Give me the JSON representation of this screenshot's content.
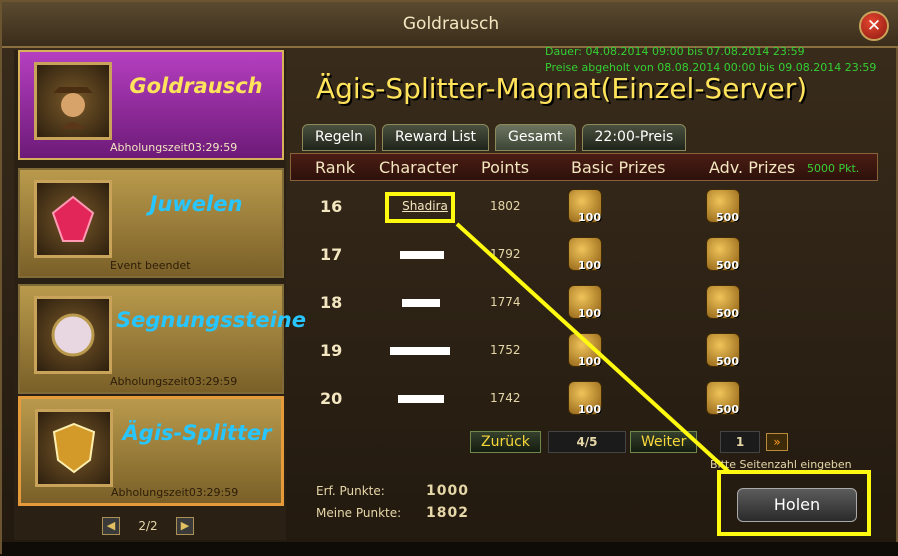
{
  "window": {
    "title": "Goldrausch",
    "close_label": "✕"
  },
  "sidebar": {
    "cards": [
      {
        "name": "Goldrausch",
        "sub": "Abholungszeit03:29:59",
        "state": "active",
        "icon": "cowboy-portrait-icon"
      },
      {
        "name": "Juwelen",
        "sub": "Event beendet",
        "state": "normal",
        "icon": "gem-icon"
      },
      {
        "name": "Segnungssteine",
        "sub": "Abholungszeit03:29:59",
        "state": "normal",
        "icon": "pearl-icon"
      },
      {
        "name": "Ägis-Splitter",
        "sub": "Abholungszeit03:29:59",
        "state": "selected",
        "icon": "shield-icon"
      }
    ],
    "pager": {
      "prev": "◀",
      "label": "2/2",
      "next": "▶"
    }
  },
  "event": {
    "dates": {
      "duration": "Dauer: 04.08.2014 09:00 bis 07.08.2014 23:59",
      "claimed": "Preise abgeholt von 08.08.2014 00:00 bis 09.08.2014 23:59"
    },
    "title": "Ägis-Splitter-Magnat(Einzel-Server)"
  },
  "tabs": [
    {
      "label": "Regeln",
      "active": false
    },
    {
      "label": "Reward List",
      "active": false
    },
    {
      "label": "Gesamt",
      "active": true
    },
    {
      "label": "22:00-Preis",
      "active": false
    }
  ],
  "table": {
    "headers": {
      "rank": "Rank",
      "character": "Character",
      "points": "Points",
      "basic": "Basic Prizes",
      "adv": "Adv. Prizes",
      "adv_threshold": "5000 Pkt."
    },
    "rows": [
      {
        "rank": "16",
        "character": "Shadira",
        "points": "1802",
        "basic": "100",
        "adv": "500"
      },
      {
        "rank": "17",
        "character": "",
        "points": "1792",
        "basic": "100",
        "adv": "500"
      },
      {
        "rank": "18",
        "character": "",
        "points": "1774",
        "basic": "100",
        "adv": "500"
      },
      {
        "rank": "19",
        "character": "",
        "points": "1752",
        "basic": "100",
        "adv": "500"
      },
      {
        "rank": "20",
        "character": "",
        "points": "1742",
        "basic": "100",
        "adv": "500"
      }
    ]
  },
  "pagination": {
    "back_label": "Zurück",
    "page": "4/5",
    "next_label": "Weiter",
    "input_value": "1",
    "go_label": "»",
    "hint": "Bitte Seitenzahl eingeben"
  },
  "points": {
    "required_label": "Erf. Punkte:",
    "required_value": "1000",
    "mine_label": "Meine Punkte:",
    "mine_value": "1802"
  },
  "actions": {
    "holen_label": "Holen"
  },
  "colors": {
    "highlight": "#fffa10",
    "accent_gold": "#ffe35a",
    "active_purple": "#b53fc0",
    "green_text": "#34d034"
  }
}
